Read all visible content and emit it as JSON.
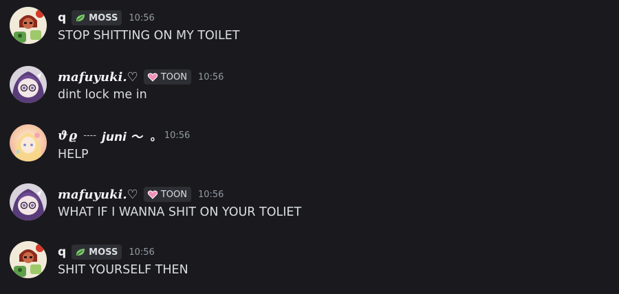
{
  "messages": [
    {
      "username": "q",
      "tag": "MOSS",
      "tag_icon": "leaf-icon",
      "time": "10:56",
      "text": "STOP SHITTING ON MY TOILET"
    },
    {
      "username": "mafuyuki.♡",
      "tag": "TOON",
      "tag_icon": "heart-icon",
      "time": "10:56",
      "text": "dint lock me in"
    },
    {
      "username_prefix": "ϑϱ",
      "username_dots": "----",
      "username": "juni ～",
      "username_suffix": "。",
      "time": "10:56",
      "text": "HELP"
    },
    {
      "username": "mafuyuki.♡",
      "tag": "TOON",
      "tag_icon": "heart-icon",
      "time": "10:56",
      "text": "WHAT IF I WANNA SHIT ON YOUR TOLIET"
    },
    {
      "username": "q",
      "tag": "MOSS",
      "tag_icon": "leaf-icon",
      "time": "10:56",
      "text": "SHIT YOURSELF THEN"
    }
  ],
  "colors": {
    "background": "#1a1a1e",
    "username": "#f2f3f5",
    "message_text": "#dbdee1",
    "timestamp": "#949ba4",
    "tag_background": "#2e2f35",
    "leaf": "#7bc86c",
    "heart": "#f28fb8"
  }
}
